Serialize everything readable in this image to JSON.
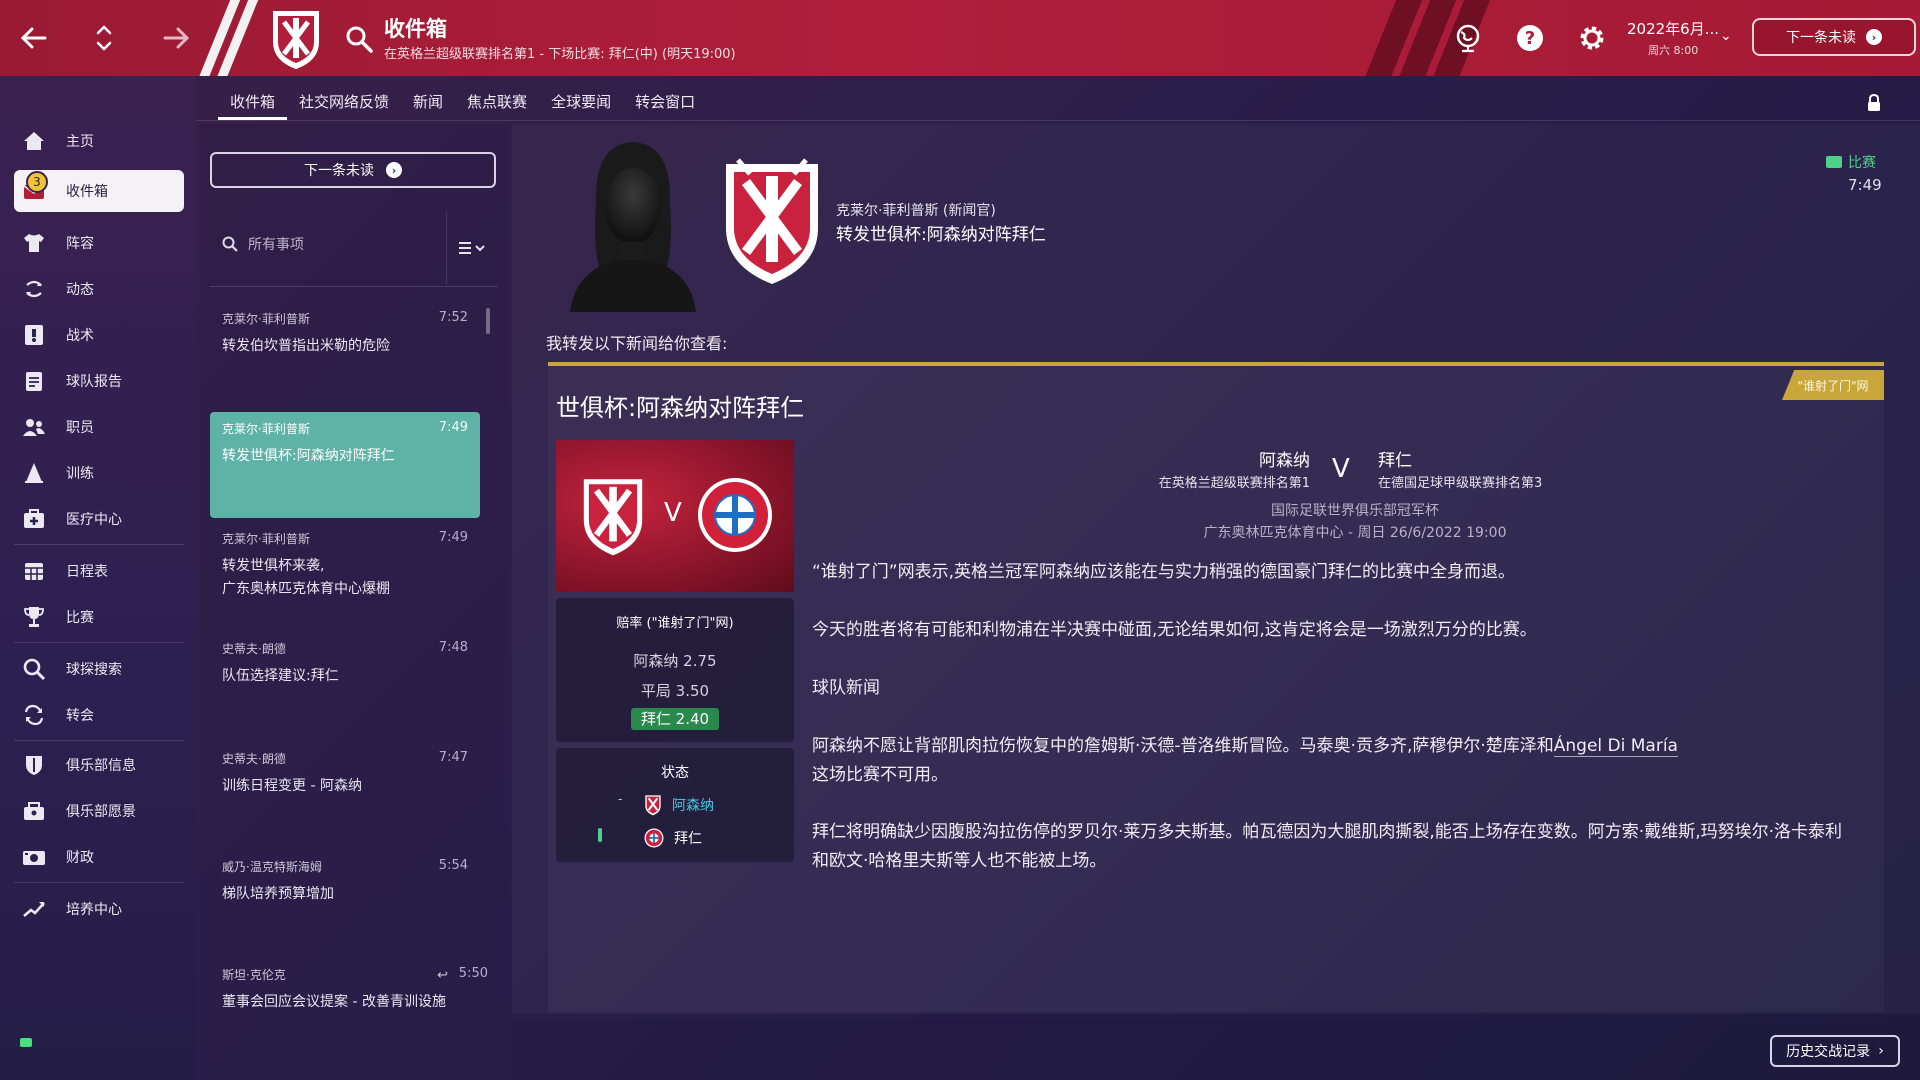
{
  "topbar": {
    "title": "收件箱",
    "subtitle": "在英格兰超级联赛排名第1 - 下场比赛: 拜仁(中) (明天19:00)",
    "date": "2022年6月...",
    "day": "周六 8:00",
    "next_unread": "下一条未读",
    "accent": "#b01e3a"
  },
  "sidebar": {
    "items": [
      {
        "label": "主页",
        "icon": "home-icon"
      },
      {
        "label": "收件箱",
        "icon": "inbox-icon",
        "badge": "3"
      },
      {
        "label": "阵容",
        "icon": "shirt-icon"
      },
      {
        "label": "动态",
        "icon": "dynamics-icon"
      },
      {
        "label": "战术",
        "icon": "tactics-icon"
      },
      {
        "label": "球队报告",
        "icon": "report-icon"
      },
      {
        "label": "职员",
        "icon": "staff-icon"
      },
      {
        "label": "训练",
        "icon": "training-icon"
      },
      {
        "label": "医疗中心",
        "icon": "medical-icon"
      },
      {
        "label": "日程表",
        "icon": "calendar-icon"
      },
      {
        "label": "比赛",
        "icon": "trophy-icon"
      },
      {
        "label": "球探搜索",
        "icon": "scout-search-icon"
      },
      {
        "label": "转会",
        "icon": "transfer-icon"
      },
      {
        "label": "俱乐部信息",
        "icon": "shield-icon"
      },
      {
        "label": "俱乐部愿景",
        "icon": "vision-icon"
      },
      {
        "label": "财政",
        "icon": "finance-icon"
      },
      {
        "label": "培养中心",
        "icon": "development-icon"
      }
    ]
  },
  "tabs": [
    "收件箱",
    "社交网络反馈",
    "新闻",
    "焦点联赛",
    "全球要闻",
    "转会窗口"
  ],
  "inbox": {
    "next_unread": "下一条未读",
    "search_placeholder": "所有事项",
    "messages": [
      {
        "sender": "克莱尔·菲利普斯",
        "time": "7:52",
        "subject": "转发伯坎普指出米勒的危险"
      },
      {
        "sender": "克莱尔·菲利普斯",
        "time": "7:49",
        "subject": "转发世俱杯:阿森纳对阵拜仁"
      },
      {
        "sender": "克莱尔·菲利普斯",
        "time": "7:49",
        "subject": "转发世俱杯来袭,\n广东奥林匹克体育中心爆棚"
      },
      {
        "sender": "史蒂夫·朗德",
        "time": "7:48",
        "subject": "队伍选择建议:拜仁"
      },
      {
        "sender": "史蒂夫·朗德",
        "time": "7:47",
        "subject": "训练日程变更 - 阿森纳"
      },
      {
        "sender": "威乃·温克特斯海姆",
        "time": "5:54",
        "subject": "梯队培养预算增加"
      },
      {
        "sender": "斯坦·克伦克",
        "time": "5:50",
        "subject": "董事会回应会议提案 - 改善青训设施"
      }
    ]
  },
  "message": {
    "sender": "克莱尔·菲利普斯 (新闻官)",
    "subject": "转发世俱杯:阿森纳对阵拜仁",
    "tag": "比赛",
    "time": "7:49",
    "intro": "我转发以下新闻给你查看:",
    "history_button": "历史交战记录"
  },
  "news": {
    "source": "\"谁射了门\"网",
    "title": "世俱杯:阿森纳对阵拜仁",
    "versus": "V",
    "home": {
      "name": "阿森纳",
      "position": "在英格兰超级联赛排名第1"
    },
    "away": {
      "name": "拜仁",
      "position": "在德国足球甲级联赛排名第3"
    },
    "competition": "国际足联世界俱乐部冠军杯",
    "venue": "广东奥林匹克体育中心 - 周日 26/6/2022 19:00",
    "odds": {
      "title": "赔率 (\"谁射了门\"网)",
      "home": "阿森纳 2.75",
      "draw": "平局 3.50",
      "away": "拜仁 2.40"
    },
    "form": {
      "title": "状态",
      "home": "阿森纳",
      "away": "拜仁",
      "home_marker": "-"
    },
    "paragraphs": {
      "p1": "“谁射了门”网表示,英格兰冠军阿森纳应该能在与实力稍强的德国豪门拜仁的比赛中全身而退。",
      "p2": "今天的胜者将有可能和利物浦在半决赛中碰面,无论结果如何,这肯定将会是一场激烈万分的比赛。",
      "p3": "球队新闻",
      "p4a": "阿森纳不愿让背部肌肉拉伤恢复中的詹姆斯·沃德-普洛维斯冒险。马泰奥·贡多齐,萨穆伊尔·楚库泽和",
      "p4b": "Ángel Di María",
      "p4c": "这场比赛不可用。",
      "p5": "拜仁将明确缺少因腹股沟拉伤停的罗贝尔·莱万多夫斯基。帕瓦德因为大腿肌肉撕裂,能否上场存在变数。阿方索·戴维斯,玛努埃尔·洛卡泰利和欧文·哈格里夫斯等人也不能被上场。"
    }
  }
}
